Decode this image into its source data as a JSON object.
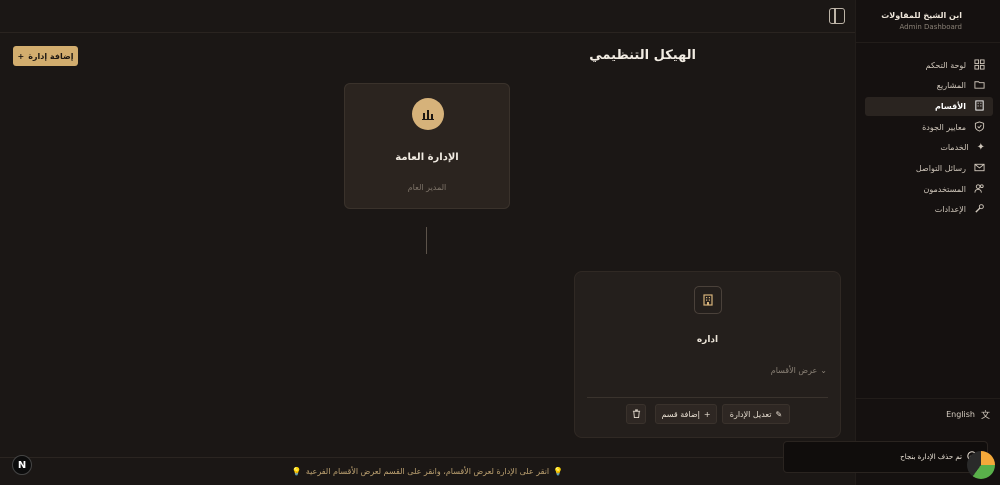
{
  "header": {
    "add_admin_label": "إضافة إدارة",
    "page_title": "الهيكل التنظيمي"
  },
  "org": {
    "top": {
      "name": "الإدارة العامة",
      "role": "المدير العام"
    },
    "department": {
      "name": "اداره",
      "show_sections": "عرض الأقسام",
      "edit_label": "تعديل الإدارة",
      "add_section_label": "إضافة قسم"
    }
  },
  "hint": {
    "text": "انقر على الإدارة لعرض الأقسام، وانقر على القسم لعرض الأقسام الفرعية"
  },
  "sidebar": {
    "brand_title": "ابن الشيخ للمقاولات",
    "brand_subtitle": "Admin Dashboard",
    "items": [
      {
        "label": "لوحة التحكم",
        "icon": "dashboard-icon"
      },
      {
        "label": "المشاريع",
        "icon": "folder-icon"
      },
      {
        "label": "الأقسام",
        "icon": "building-icon",
        "active": true
      },
      {
        "label": "معايير الجودة",
        "icon": "shield-check-icon"
      },
      {
        "label": "الخدمات",
        "icon": "sparkles-icon"
      },
      {
        "label": "رسائل التواصل",
        "icon": "mail-icon"
      },
      {
        "label": "المستخدمون",
        "icon": "users-icon"
      },
      {
        "label": "الإعدادات",
        "icon": "wrench-icon"
      }
    ],
    "language_label": "English"
  },
  "toast": {
    "text": "تم حذف الإدارة بنجاح"
  },
  "badge": {
    "letter": "N"
  },
  "colors": {
    "accent": "#d2ad6e",
    "background": "#1b1715",
    "sidebar": "#151110"
  }
}
